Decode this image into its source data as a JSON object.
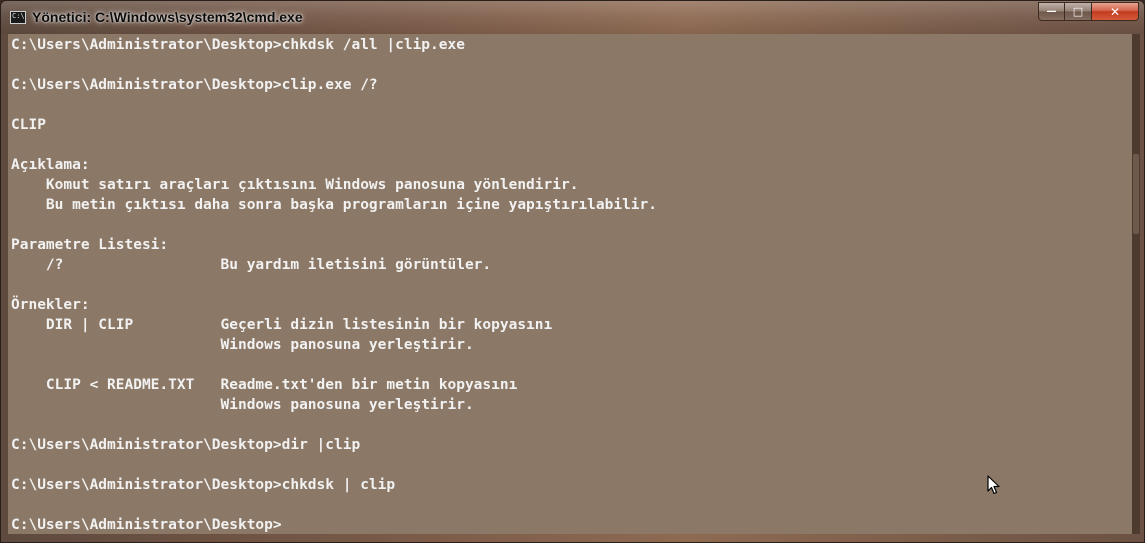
{
  "window": {
    "title": "Yönetici: C:\\Windows\\system32\\cmd.exe",
    "icon": "cmd-console-icon",
    "icon_label": "C:\\"
  },
  "controls": {
    "minimize_icon": "minimize-icon",
    "minimize_glyph": "—",
    "maximize_icon": "maximize-icon",
    "maximize_glyph": "□",
    "close_icon": "close-icon",
    "close_glyph": "✕"
  },
  "console": {
    "background": "#8b7866",
    "foreground": "#f2f2f2",
    "lines": [
      "C:\\Users\\Administrator\\Desktop>chkdsk /all |clip.exe",
      "",
      "C:\\Users\\Administrator\\Desktop>clip.exe /?",
      "",
      "CLIP",
      "",
      "Açıklama:",
      "    Komut satırı araçları çıktısını Windows panosuna yönlendirir.",
      "    Bu metin çıktısı daha sonra başka programların içine yapıştırılabilir.",
      "",
      "Parametre Listesi:",
      "    /?                  Bu yardım iletisini görüntüler.",
      "",
      "Örnekler:",
      "    DIR | CLIP          Geçerli dizin listesinin bir kopyasını",
      "                        Windows panosuna yerleştirir.",
      "",
      "    CLIP < README.TXT   Readme.txt'den bir metin kopyasını",
      "                        Windows panosuna yerleştirir.",
      "",
      "C:\\Users\\Administrator\\Desktop>dir |clip",
      "",
      "C:\\Users\\Administrator\\Desktop>chkdsk | clip",
      "",
      "C:\\Users\\Administrator\\Desktop>"
    ]
  },
  "mouse_cursor": "arrow-cursor-icon"
}
